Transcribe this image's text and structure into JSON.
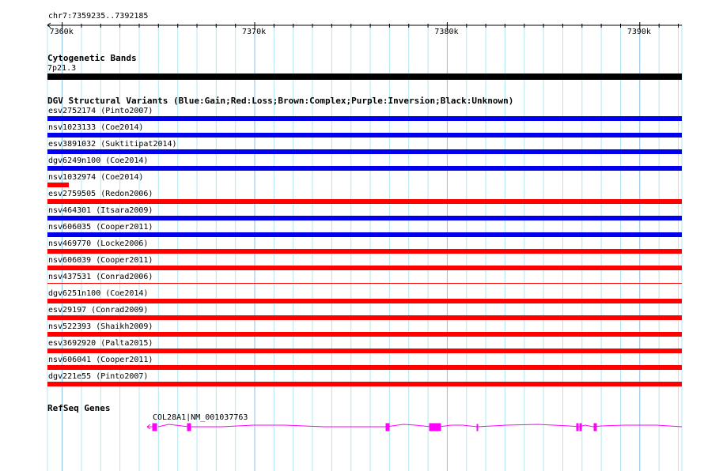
{
  "ruler": {
    "range_label": "chr7:7359235..7392185",
    "start": 7359235,
    "end": 7392185,
    "ticks": [
      "7360k",
      "7370k",
      "7380k",
      "7390k"
    ]
  },
  "cyto": {
    "title": "Cytogenetic Bands",
    "band": "7p21.3"
  },
  "dgv": {
    "title": "DGV Structural Variants (Blue:Gain;Red:Loss;Brown:Complex;Purple:Inversion;Black:Unknown)",
    "colors": {
      "gain": "#0000ee",
      "loss": "#ff0000"
    },
    "items": [
      {
        "label": "esv2752174 (Pinto2007)",
        "type": "gain",
        "style": "full"
      },
      {
        "label": "nsv1023133 (Coe2014)",
        "type": "gain",
        "style": "full"
      },
      {
        "label": "esv3891032 (Suktitipat2014)",
        "type": "gain",
        "style": "full"
      },
      {
        "label": "dgv6249n100 (Coe2014)",
        "type": "gain",
        "style": "full"
      },
      {
        "label": "nsv1032974 (Coe2014)",
        "type": "loss",
        "style": "short"
      },
      {
        "label": "esv2759505 (Redon2006)",
        "type": "loss",
        "style": "full"
      },
      {
        "label": "nsv464301 (Itsara2009)",
        "type": "gain",
        "style": "full"
      },
      {
        "label": "nsv606035 (Cooper2011)",
        "type": "gain",
        "style": "full"
      },
      {
        "label": "nsv469770 (Locke2006)",
        "type": "loss",
        "style": "full"
      },
      {
        "label": "nsv606039 (Cooper2011)",
        "type": "loss",
        "style": "full"
      },
      {
        "label": "nsv437531 (Conrad2006)",
        "type": "loss",
        "style": "thin"
      },
      {
        "label": "dgv6251n100 (Coe2014)",
        "type": "loss",
        "style": "full"
      },
      {
        "label": "esv29197 (Conrad2009)",
        "type": "loss",
        "style": "full"
      },
      {
        "label": "nsv522393 (Shaikh2009)",
        "type": "loss",
        "style": "full"
      },
      {
        "label": "esv3692920 (Palta2015)",
        "type": "loss",
        "style": "full"
      },
      {
        "label": "nsv606041 (Cooper2011)",
        "type": "loss",
        "style": "full"
      },
      {
        "label": "dgv221e55 (Pinto2007)",
        "type": "loss",
        "style": "full"
      }
    ]
  },
  "refseq": {
    "title": "RefSeq Genes",
    "gene_label": "COL28A1|NM_001037763",
    "color": "#ff00ff"
  }
}
